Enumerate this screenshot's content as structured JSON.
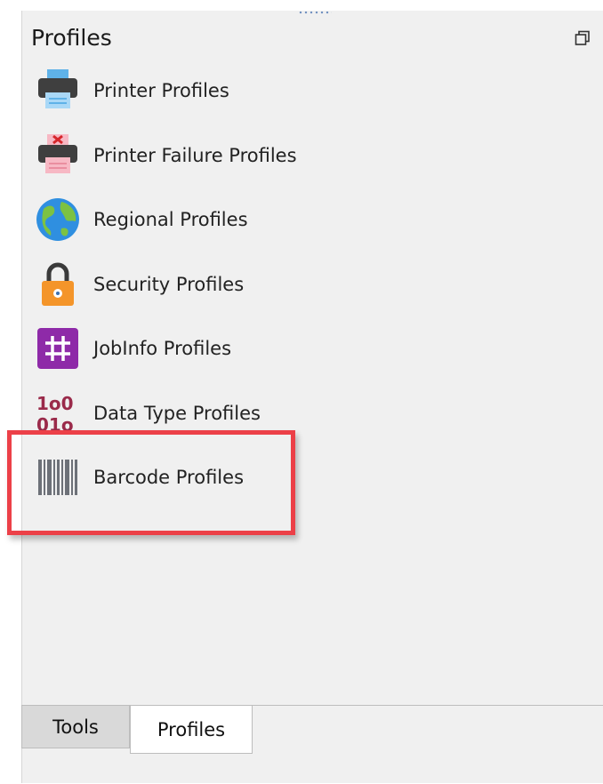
{
  "panel": {
    "title": "Profiles",
    "restore_icon": "restore-window-icon"
  },
  "items": [
    {
      "label": "Printer Profiles",
      "icon": "printer-icon"
    },
    {
      "label": "Printer Failure Profiles",
      "icon": "printer-failure-icon"
    },
    {
      "label": "Regional Profiles",
      "icon": "globe-icon"
    },
    {
      "label": "Security Profiles",
      "icon": "lock-icon"
    },
    {
      "label": "JobInfo Profiles",
      "icon": "hash-icon"
    },
    {
      "label": "Data Type Profiles",
      "icon": "binary-data-icon",
      "glyph_line1": "1o0",
      "glyph_line2": "01o"
    },
    {
      "label": "Barcode Profiles",
      "icon": "barcode-icon",
      "highlighted": true
    }
  ],
  "tabs": [
    {
      "label": "Tools",
      "active": false
    },
    {
      "label": "Profiles",
      "active": true
    }
  ],
  "colors": {
    "panel_bg": "#f0f0f0",
    "highlight": "#ec4048",
    "jobinfo_purple": "#8e2aa8",
    "security_orange": "#f4952a",
    "datatype_red": "#9a2a4a"
  }
}
